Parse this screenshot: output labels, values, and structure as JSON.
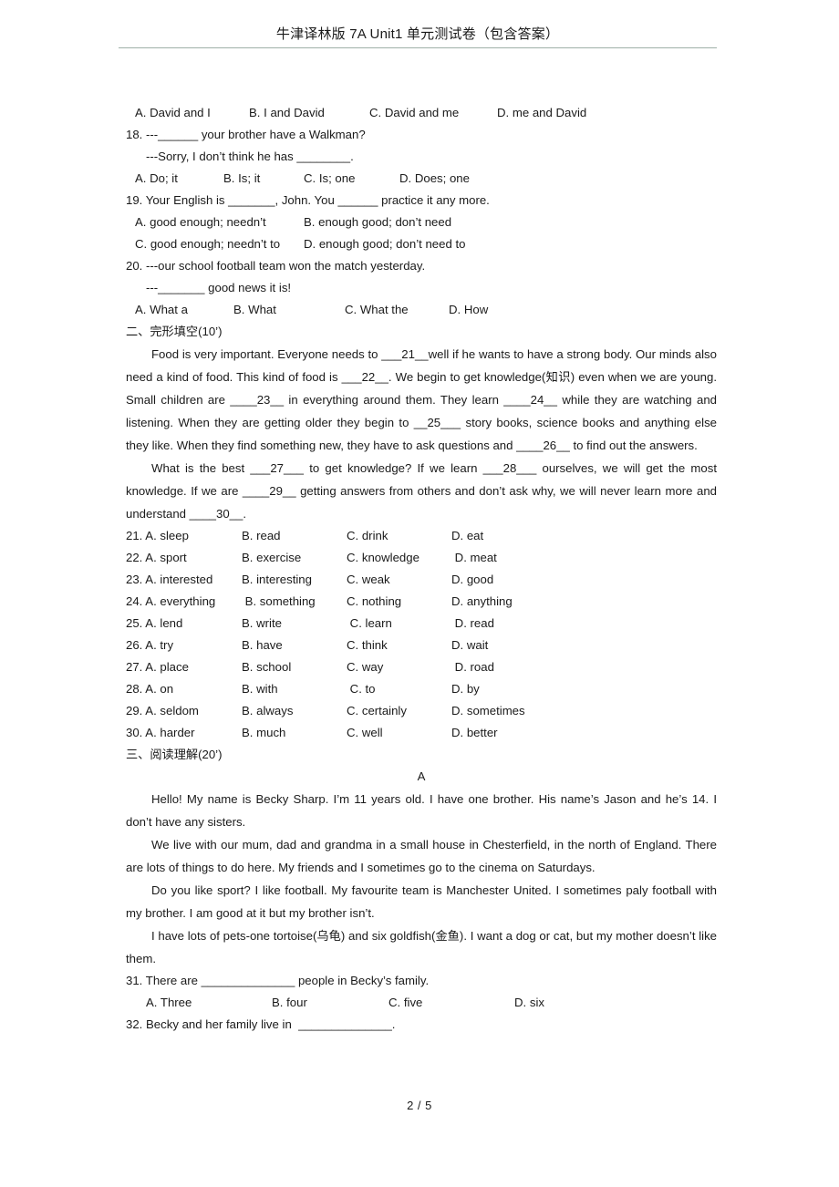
{
  "header": {
    "title": "牛津译林版  7A Unit1  单元测试卷（包含答案）"
  },
  "footer": {
    "page_label": "2 / 5"
  },
  "q17_options": {
    "a": "A. David and I",
    "b": "B. I and David",
    "c": "C. David and me",
    "d": "D. me and David"
  },
  "q18": {
    "stem": "18. ---______ your brother have a Walkman?",
    "reply": "---Sorry, I don’t think he has ________.",
    "options": {
      "a": "A. Do; it",
      "b": "B. Is; it",
      "c": "C. Is; one",
      "d": "D. Does; one"
    }
  },
  "q19": {
    "stem": "19. Your English is _______, John. You ______ practice it any more.",
    "options": {
      "a": "A. good enough; needn’t",
      "b": "B. enough good; don’t need",
      "c": "C. good enough; needn’t to",
      "d": "D. enough good; don’t need to"
    }
  },
  "q20": {
    "stem": "20. ---our school football team won the match yesterday.",
    "reply": "---_______ good news it is!",
    "options": {
      "a": "A. What a",
      "b": "B. What",
      "c": "C. What the",
      "d": "D. How"
    }
  },
  "section_cloze": {
    "heading": "二、完形填空(10’)",
    "para1": "Food is very important. Everyone needs to ___21__well if he wants to have a strong body. Our minds also need a kind of food. This kind of food is ___22__. We begin to get knowledge(知识) even when we are young. Small children are ____23__ in everything around them. They learn ____24__ while they are watching and listening. When they are getting older they begin to __25___ story books, science books and anything else they like. When they find something new, they have to ask questions and ____26__ to find out the answers.",
    "para2": "What is the best ___27___ to get knowledge? If we learn ___28___ ourselves, we will get the most knowledge. If we are ____29__ getting answers from others and don’t ask why, we will never learn more and understand ____30__."
  },
  "cloze_options": [
    {
      "num": "21. A. sleep",
      "b": "B. read",
      "c": "C. drink",
      "d": "D. eat"
    },
    {
      "num": "22. A. sport",
      "b": "B. exercise",
      "c": "C. knowledge",
      "d": " D. meat"
    },
    {
      "num": "23. A. interested",
      "b": "B. interesting",
      "c": "C. weak",
      "d": "D. good"
    },
    {
      "num": "24. A. everything",
      "b": " B. something",
      "c": "C. nothing",
      "d": "D. anything"
    },
    {
      "num": "25. A. lend",
      "b": "B. write",
      "c": " C. learn",
      "d": " D. read"
    },
    {
      "num": "26. A. try",
      "b": "B. have",
      "c": "C. think",
      "d": "D. wait"
    },
    {
      "num": "27. A. place",
      "b": "B. school",
      "c": "C. way",
      "d": " D. road"
    },
    {
      "num": "28. A. on",
      "b": "B. with",
      "c": " C. to",
      "d": "D. by"
    },
    {
      "num": "29. A. seldom",
      "b": "B. always",
      "c": "C. certainly",
      "d": "D. sometimes"
    },
    {
      "num": "30. A. harder",
      "b": "B. much",
      "c": "C. well",
      "d": "D. better"
    }
  ],
  "section_reading": {
    "heading": "三、阅读理解(20’)",
    "passage_label": "A",
    "para1": "Hello! My name is Becky Sharp. I’m 11 years old. I have one brother. His name’s Jason and he’s 14. I don’t have any sisters.",
    "para2": "We live with our mum, dad and grandma in a small house in Chesterfield, in the north of England. There are lots of things to do here. My friends and I sometimes go to the cinema on Saturdays.",
    "para3": "Do you like sport? I like football. My favourite team is Manchester United. I sometimes paly football with my brother. I am good at it but my brother isn’t.",
    "para4": "I have lots of pets-one tortoise(乌龟) and six goldfish(金鱼). I want a dog or cat, but my mother doesn’t like them."
  },
  "q31": {
    "stem": "31. There are ______________ people in Becky’s family.",
    "options": {
      "a": "A. Three",
      "b": "B. four",
      "c": "C. five",
      "d": "D. six"
    }
  },
  "q32": {
    "stem": "32. Becky and her family live in  ______________."
  }
}
